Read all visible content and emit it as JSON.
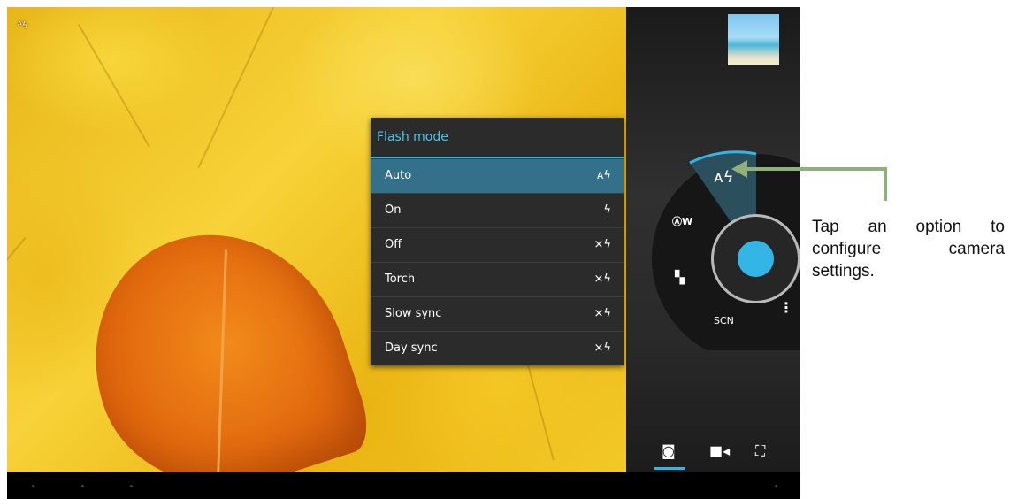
{
  "flash_menu": {
    "title": "Flash mode",
    "items": [
      {
        "label": "Auto",
        "icon": "flash-auto-icon",
        "selected": true
      },
      {
        "label": "On",
        "icon": "flash-on-icon",
        "selected": false
      },
      {
        "label": "Off",
        "icon": "flash-off-icon",
        "selected": false
      },
      {
        "label": "Torch",
        "icon": "flash-off-icon",
        "selected": false
      },
      {
        "label": "Slow sync",
        "icon": "flash-off-icon",
        "selected": false
      },
      {
        "label": "Day sync",
        "icon": "flash-off-icon",
        "selected": false
      }
    ]
  },
  "dial": {
    "scene_label": "SCN",
    "white_balance_label": "W"
  },
  "mode_tabs": [
    "camera-icon",
    "video-icon",
    "panorama-icon"
  ],
  "callout": {
    "text": "Tap an option to configure camera settings."
  },
  "colors": {
    "accent": "#33b5e5",
    "menu_bg": "#2b2b2b",
    "selected_row": "#34708a",
    "callout_arrow": "#8eb07a"
  }
}
